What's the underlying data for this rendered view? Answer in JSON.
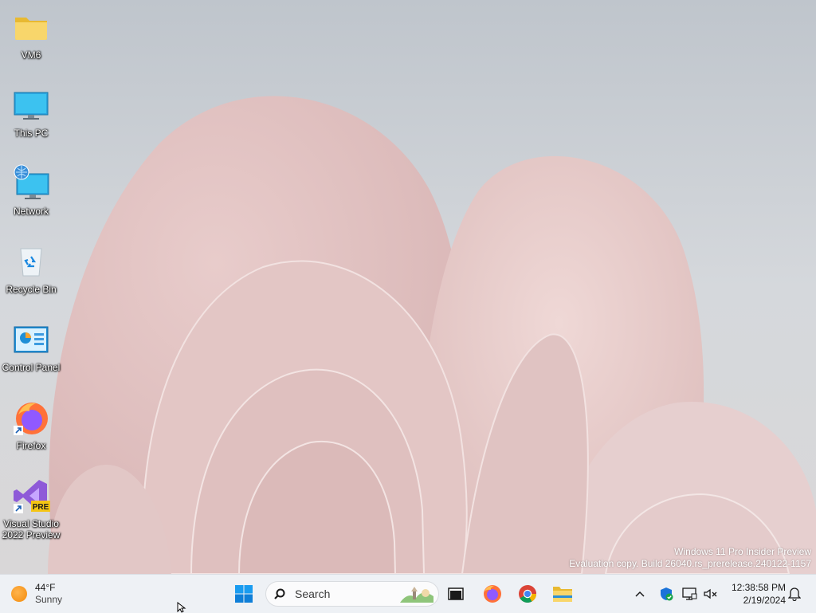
{
  "desktop": {
    "icons": [
      {
        "label": "VM6",
        "icon": "folder-icon"
      },
      {
        "label": "This PC",
        "icon": "computer-icon"
      },
      {
        "label": "Network",
        "icon": "network-icon"
      },
      {
        "label": "Recycle Bin",
        "icon": "recycle-bin-icon"
      },
      {
        "label": "Control Panel",
        "icon": "control-panel-icon"
      },
      {
        "label": "Firefox",
        "icon": "firefox-icon"
      },
      {
        "label": "Visual Studio 2022 Preview",
        "icon": "visual-studio-icon",
        "badge": "PRE"
      }
    ]
  },
  "watermark": {
    "line1": "Windows 11 Pro Insider Preview",
    "line2": "Evaluation copy. Build 26040.rs_prerelease.240122-1157"
  },
  "taskbar": {
    "weather": {
      "temp": "44°F",
      "condition": "Sunny"
    },
    "search": {
      "placeholder": "Search"
    },
    "pinned": [
      "start-button",
      "task-view-button",
      "firefox-taskbar-button",
      "chrome-taskbar-button",
      "file-explorer-taskbar-button"
    ],
    "clock": {
      "time": "12:38:58 PM",
      "date": "2/19/2024"
    }
  },
  "colors": {
    "taskbar_bg": "#eef1f5",
    "accent_blue": "#0078d4",
    "wallpaper_petal": "#e7cdcd"
  }
}
